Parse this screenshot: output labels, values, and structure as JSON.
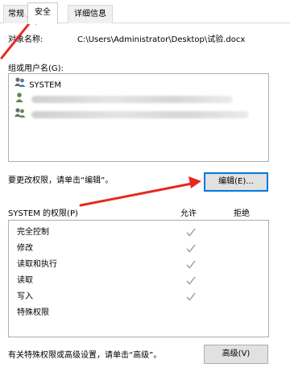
{
  "tabs": [
    {
      "label": "常规"
    },
    {
      "label": "安全"
    },
    {
      "label": "详细信息"
    }
  ],
  "object_name": {
    "label": "对象名称:",
    "value": "C:\\Users\\Administrator\\Desktop\\试验.docx"
  },
  "groups": {
    "label": "组或用户名(G):",
    "items": [
      {
        "name": "SYSTEM",
        "icon": "user-group-icon",
        "blurred": false
      },
      {
        "name": "",
        "icon": "user-icon",
        "blurred": true
      },
      {
        "name": "",
        "icon": "user-group-icon",
        "blurred": true
      }
    ]
  },
  "change_permissions": {
    "text": "要更改权限，请单击“编辑”。",
    "button": "编辑(E)..."
  },
  "permissions": {
    "title": "SYSTEM 的权限(P)",
    "allow_header": "允许",
    "deny_header": "拒绝",
    "rows": [
      {
        "name": "完全控制",
        "allow": true,
        "deny": false
      },
      {
        "name": "修改",
        "allow": true,
        "deny": false
      },
      {
        "name": "读取和执行",
        "allow": true,
        "deny": false
      },
      {
        "name": "读取",
        "allow": true,
        "deny": false
      },
      {
        "name": "写入",
        "allow": true,
        "deny": false
      },
      {
        "name": "特殊权限",
        "allow": false,
        "deny": false
      }
    ]
  },
  "advanced": {
    "text": "有关特殊权限或高级设置，请单击“高级”。",
    "button": "高级(V)"
  },
  "colors": {
    "annotation_arrow": "#e8281e",
    "checkmark": "#a8a8a8",
    "focus_border": "#0078d7"
  }
}
